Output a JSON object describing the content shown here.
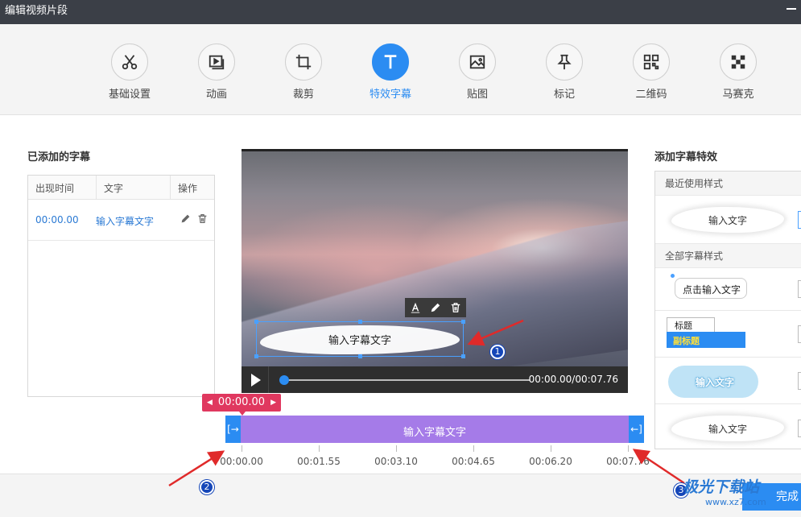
{
  "window": {
    "title": "编辑视频片段"
  },
  "toolbar": {
    "tools": [
      {
        "label": "基础设置",
        "icon": "scissors-icon"
      },
      {
        "label": "动画",
        "icon": "animation-icon"
      },
      {
        "label": "裁剪",
        "icon": "crop-icon"
      },
      {
        "label": "特效字幕",
        "icon": "text-t-icon",
        "active": true
      },
      {
        "label": "贴图",
        "icon": "image-icon"
      },
      {
        "label": "标记",
        "icon": "pin-icon"
      },
      {
        "label": "二维码",
        "icon": "qrcode-icon"
      },
      {
        "label": "马赛克",
        "icon": "mosaic-icon"
      }
    ],
    "accent": "#2b8cf2"
  },
  "left_panel": {
    "title": "已添加的字幕",
    "columns": [
      "出现时间",
      "文字",
      "操作"
    ],
    "rows": [
      {
        "time": "00:00.00",
        "text": "输入字幕文字"
      }
    ]
  },
  "preview": {
    "caption_text": "输入字幕文字",
    "time_display": "00:00.00/00:07.76",
    "progress": 0.0
  },
  "timeline": {
    "current_tag": "00:00.00",
    "clip_label": "输入字幕文字",
    "ticks": [
      "00:00.00",
      "00:01.55",
      "00:03.10",
      "00:04.65",
      "00:06.20",
      "00:07.76"
    ],
    "clip_color": "#a57be8",
    "tag_color": "#e0385f"
  },
  "right_panel": {
    "title": "添加字幕特效",
    "recent_section": "最近使用样式",
    "recent_item": "输入文字",
    "all_section": "全部字幕样式",
    "styles": [
      {
        "text": "点击输入文字"
      },
      {
        "title": "标题",
        "subtitle": "副标题"
      },
      {
        "text": "输入文字"
      },
      {
        "text": "输入文字"
      }
    ]
  },
  "footer": {
    "done_label": "完成"
  },
  "annotations": {
    "badges": [
      "1",
      "2",
      "3"
    ]
  },
  "watermark": {
    "line1": "极光下载站",
    "line2": "www.xz7.com"
  }
}
